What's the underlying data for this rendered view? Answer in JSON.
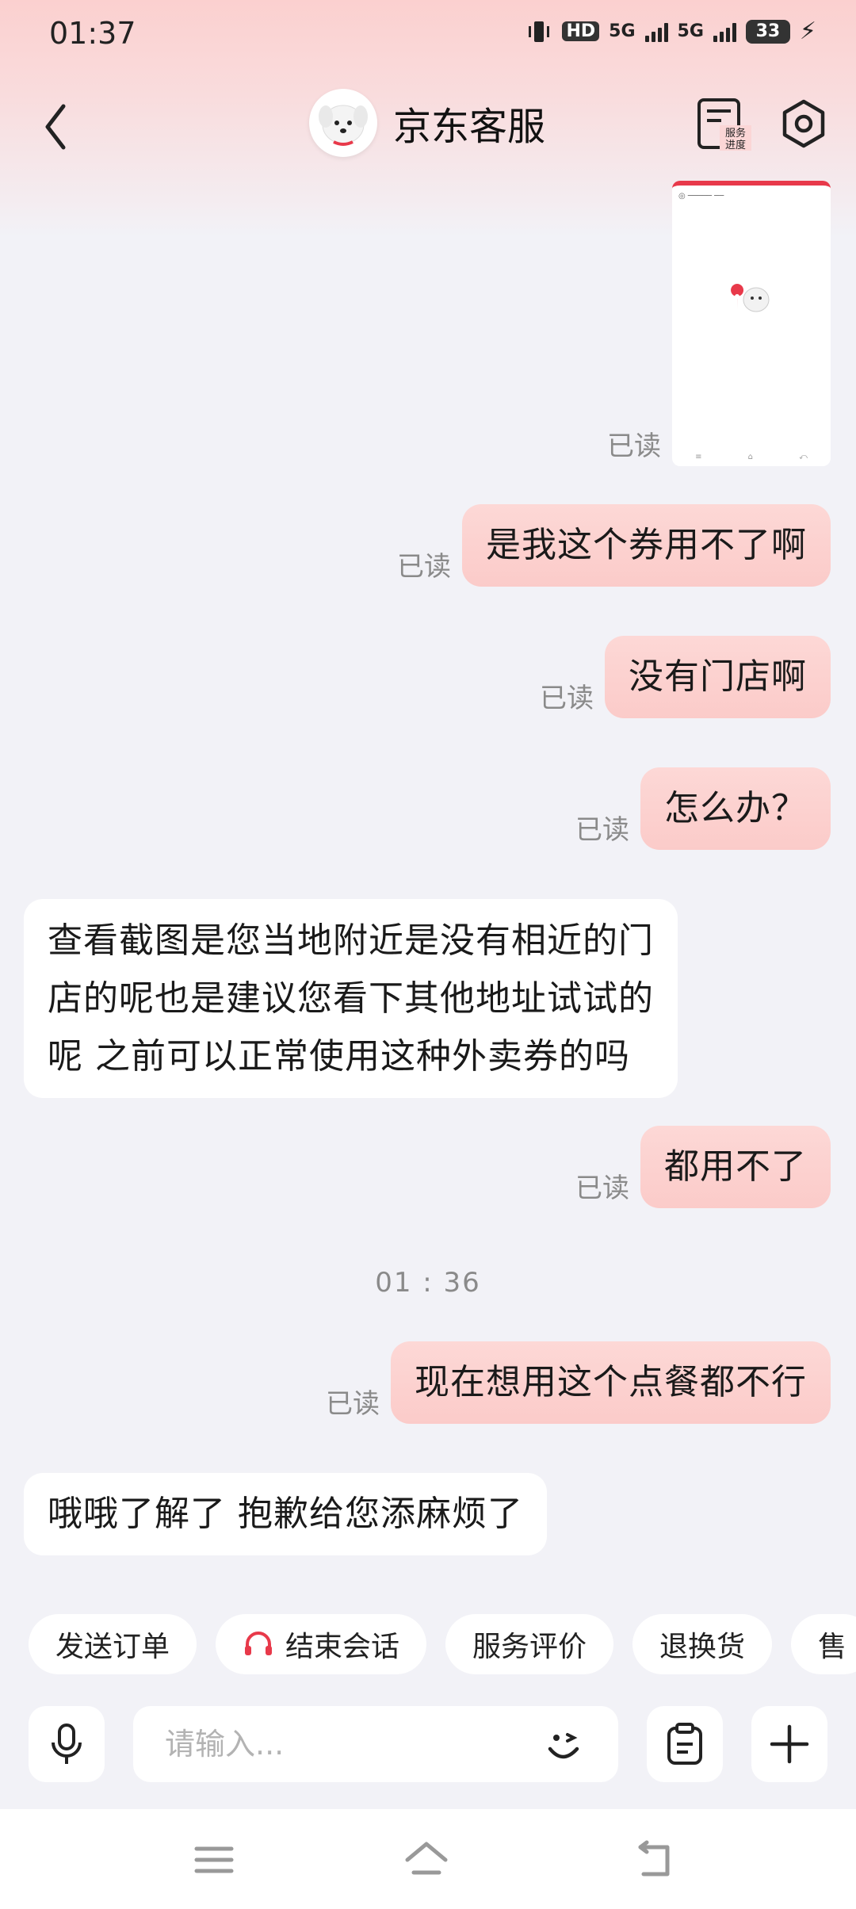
{
  "status_bar": {
    "time": "01:37",
    "hd_label": "HD",
    "net1": "5G",
    "net2": "5G",
    "battery": "33"
  },
  "header": {
    "title": "京东客服",
    "service_progress_label": "服务进度"
  },
  "messages": {
    "image_read": "已读",
    "m1": {
      "text": "是我这个券用不了啊",
      "status": "已读"
    },
    "m2": {
      "text": "没有门店啊",
      "status": "已读"
    },
    "m3": {
      "text": "怎么办？",
      "status": "已读"
    },
    "m4": {
      "lines": [
        "查看截图是您当地附近是没有相近的门",
        "店的呢也是建议您看下其他地址试试的",
        "呢 之前可以正常使用这种外卖券的吗"
      ]
    },
    "m5": {
      "text": "都用不了",
      "status": "已读"
    },
    "timestamp": "01 : 36",
    "m6": {
      "text": "现在想用这个点餐都不行",
      "status": "已读"
    },
    "m7": {
      "text": "哦哦了解了 抱歉给您添麻烦了"
    }
  },
  "quick_actions": [
    "发送订单",
    "结束会话",
    "服务评价",
    "退换货",
    "售"
  ],
  "input": {
    "placeholder": "请输入..."
  },
  "colors": {
    "accent": "#e8394a",
    "bubble_out": "#fbcbc9",
    "bubble_in": "#ffffff",
    "background": "#f2f2f7"
  }
}
